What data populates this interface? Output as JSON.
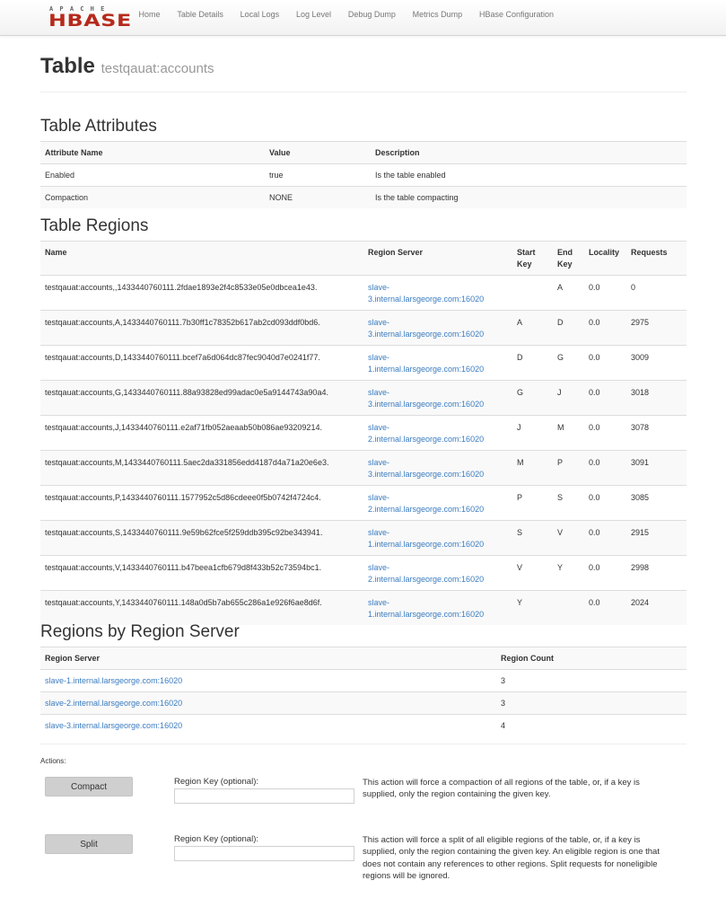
{
  "nav": {
    "logo_top": "APACHE",
    "logo_main": "HBASE",
    "items": [
      "Home",
      "Table Details",
      "Local Logs",
      "Log Level",
      "Debug Dump",
      "Metrics Dump",
      "HBase Configuration"
    ]
  },
  "header": {
    "title": "Table",
    "table_name": "testqauat:accounts"
  },
  "attributes": {
    "heading": "Table Attributes",
    "columns": [
      "Attribute Name",
      "Value",
      "Description"
    ],
    "rows": [
      [
        "Enabled",
        "true",
        "Is the table enabled"
      ],
      [
        "Compaction",
        "NONE",
        "Is the table compacting"
      ]
    ]
  },
  "regions": {
    "heading": "Table Regions",
    "columns": [
      "Name",
      "Region Server",
      "Start Key",
      "End Key",
      "Locality",
      "Requests"
    ],
    "rows": [
      {
        "name": "testqauat:accounts,,1433440760111.2fdae1893e2f4c8533e05e0dbcea1e43.",
        "server_a": "slave-",
        "server_b": "3.internal.larsgeorge.com:16020",
        "start": "",
        "end": "A",
        "locality": "0.0",
        "requests": "0"
      },
      {
        "name": "testqauat:accounts,A,1433440760111.7b30ff1c78352b617ab2cd093ddf0bd6.",
        "server_a": "slave-",
        "server_b": "3.internal.larsgeorge.com:16020",
        "start": "A",
        "end": "D",
        "locality": "0.0",
        "requests": "2975"
      },
      {
        "name": "testqauat:accounts,D,1433440760111.bcef7a6d064dc87fec9040d7e0241f77.",
        "server_a": "slave-",
        "server_b": "1.internal.larsgeorge.com:16020",
        "start": "D",
        "end": "G",
        "locality": "0.0",
        "requests": "3009"
      },
      {
        "name": "testqauat:accounts,G,1433440760111.88a93828ed99adac0e5a9144743a90a4.",
        "server_a": "slave-",
        "server_b": "3.internal.larsgeorge.com:16020",
        "start": "G",
        "end": "J",
        "locality": "0.0",
        "requests": "3018"
      },
      {
        "name": "testqauat:accounts,J,1433440760111.e2af71fb052aeaab50b086ae93209214.",
        "server_a": "slave-",
        "server_b": "2.internal.larsgeorge.com:16020",
        "start": "J",
        "end": "M",
        "locality": "0.0",
        "requests": "3078"
      },
      {
        "name": "testqauat:accounts,M,1433440760111.5aec2da331856edd4187d4a71a20e6e3.",
        "server_a": "slave-",
        "server_b": "3.internal.larsgeorge.com:16020",
        "start": "M",
        "end": "P",
        "locality": "0.0",
        "requests": "3091"
      },
      {
        "name": "testqauat:accounts,P,1433440760111.1577952c5d86cdeee0f5b0742f4724c4.",
        "server_a": "slave-",
        "server_b": "2.internal.larsgeorge.com:16020",
        "start": "P",
        "end": "S",
        "locality": "0.0",
        "requests": "3085"
      },
      {
        "name": "testqauat:accounts,S,1433440760111.9e59b62fce5f259ddb395c92be343941.",
        "server_a": "slave-",
        "server_b": "1.internal.larsgeorge.com:16020",
        "start": "S",
        "end": "V",
        "locality": "0.0",
        "requests": "2915"
      },
      {
        "name": "testqauat:accounts,V,1433440760111.b47beea1cfb679d8f433b52c73594bc1.",
        "server_a": "slave-",
        "server_b": "2.internal.larsgeorge.com:16020",
        "start": "V",
        "end": "Y",
        "locality": "0.0",
        "requests": "2998"
      },
      {
        "name": "testqauat:accounts,Y,1433440760111.148a0d5b7ab655c286a1e926f6ae8d6f.",
        "server_a": "slave-",
        "server_b": "1.internal.larsgeorge.com:16020",
        "start": "Y",
        "end": "",
        "locality": "0.0",
        "requests": "2024"
      }
    ]
  },
  "by_server": {
    "heading": "Regions by Region Server",
    "columns": [
      "Region Server",
      "Region Count"
    ],
    "rows": [
      [
        "slave-1.internal.larsgeorge.com:16020",
        "3"
      ],
      [
        "slave-2.internal.larsgeorge.com:16020",
        "3"
      ],
      [
        "slave-3.internal.larsgeorge.com:16020",
        "4"
      ]
    ]
  },
  "actions": {
    "label": "Actions:",
    "compact": {
      "button": "Compact",
      "field_label": "Region Key (optional):",
      "value": "",
      "description": "This action will force a compaction of all regions of the table, or, if a key is supplied, only the region containing the given key."
    },
    "split": {
      "button": "Split",
      "field_label": "Region Key (optional):",
      "value": "",
      "description": "This action will force a split of all eligible regions of the table, or, if a key is supplied, only the region containing the given key. An eligible region is one that does not contain any references to other regions. Split requests for noneligible regions will be ignored."
    }
  },
  "colors": {
    "brand": "#b52a1c",
    "link": "#3a7cc0",
    "stripe": "#f9f9f9"
  }
}
